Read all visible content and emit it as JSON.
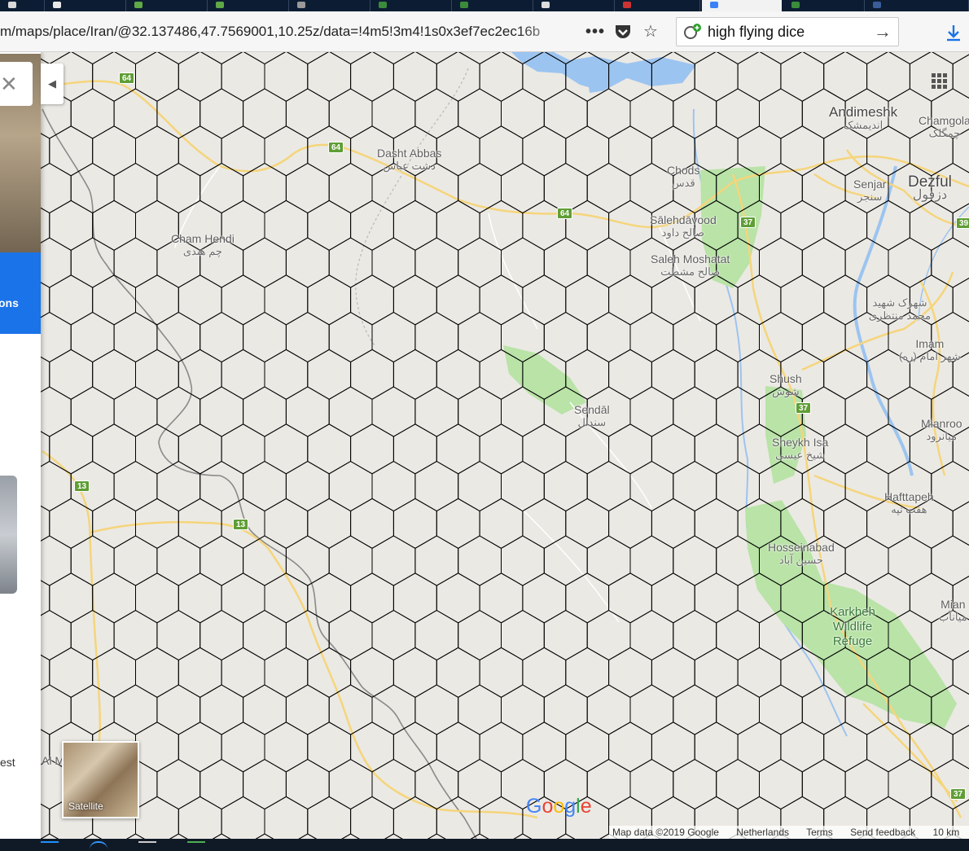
{
  "browser": {
    "tab_count": 11,
    "url": "m/maps/place/Iran/@32.137486,47.7569001,10.25z/data=!4m5!3m4!1s0x3ef7ec2ec16b",
    "menu_icon": "more-dots-icon",
    "pocket_icon": "pocket-icon",
    "bookmark_icon": "star-icon",
    "search_engine_icon": "search-engine-icon",
    "search_value": "high flying dice",
    "search_go_icon": "arrow-right-icon",
    "download_icon": "download-icon"
  },
  "map": {
    "background": "#ebe9e4",
    "road_color": "#f5d57b",
    "water_color": "#9cc4f0",
    "park_color": "#b9e3a7",
    "border_color": "#8a8a8a",
    "hex_grid_color": "#000000",
    "apps_icon": "apps-grid-icon",
    "collapse_icon": "collapse-left-icon",
    "satellite_label": "Satellite",
    "google_logo": "Google",
    "attribution": {
      "map_data": "Map data ©2019 Google",
      "country": "Netherlands",
      "terms": "Terms",
      "feedback": "Send feedback",
      "scale": "10 km"
    },
    "places": {
      "andimeshk": {
        "en": "Andimeshk",
        "fa": "اندیمشک"
      },
      "chamgolak": {
        "en": "Chamgola",
        "fa": "چمگلک"
      },
      "dezful": {
        "en": "Dezful",
        "fa": "دزفول"
      },
      "senjar": {
        "en": "Senjar",
        "fa": "سنجر"
      },
      "dasht_abbas": {
        "en": "Dasht Abbas",
        "fa": "دشت عباس"
      },
      "chods": {
        "en": "Chods",
        "fa": "قدس"
      },
      "salehdavood": {
        "en": "Sālehdāvood",
        "fa": "صالح داود"
      },
      "saleh_moshatat": {
        "en": "Saleh Moshatat",
        "fa": "صالح مشطت"
      },
      "cham_hendi": {
        "en": "Cham Hendi",
        "fa": "چم هندی"
      },
      "shahrak": {
        "en": "",
        "fa": "شهرک شهید محمد منتظری"
      },
      "imam": {
        "en": "Imam",
        "fa": "شهر امام (ره)"
      },
      "shush": {
        "en": "Shush",
        "fa": "شوش"
      },
      "sendal": {
        "en": "Sendāl",
        "fa": "سندال"
      },
      "mianrood": {
        "en": "Mianroo",
        "fa": "میانرود"
      },
      "sheykh_isa": {
        "en": "Sheykh Isa",
        "fa": "شیخ عیسی"
      },
      "hafttapeh": {
        "en": "Hafttapeh",
        "fa": "هفت تپه"
      },
      "hosseinabad": {
        "en": "Hosseinabad",
        "fa": "حسین آباد"
      },
      "mian": {
        "en": "Mian",
        "fa": "میانآب"
      },
      "karkheh": {
        "en": "Karkheh Wildlife Refuge",
        "fa": ""
      },
      "al_m": {
        "en": "Al M",
        "fa": ""
      }
    },
    "shields": {
      "r64a": "64",
      "r64b": "64",
      "r64c": "64",
      "r37a": "37",
      "r37b": "37",
      "r37c": "37",
      "r13a": "13",
      "r13b": "13",
      "r39": "39"
    }
  },
  "side_panel": {
    "close_icon": "close-icon",
    "directions_label": "ons",
    "west_label": "est"
  },
  "taskbar": {
    "icon_count": 5
  }
}
